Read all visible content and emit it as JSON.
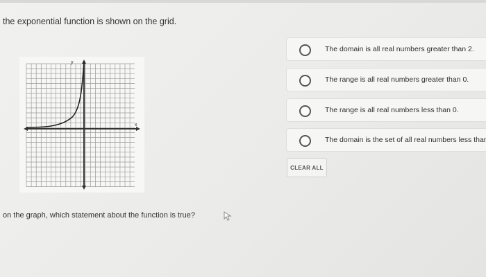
{
  "prompt": "the exponential function is shown on the grid.",
  "question": "on the graph, which statement about the function is true?",
  "options": [
    {
      "label": "The domain is all real numbers greater than 2."
    },
    {
      "label": "The range is all real numbers greater than 0."
    },
    {
      "label": "The range is all real numbers less than 0."
    },
    {
      "label": "The domain is the set of all real numbers less than"
    }
  ],
  "clear_button": "CLEAR ALL",
  "graph": {
    "axis_labels": [
      "y",
      "x"
    ]
  }
}
